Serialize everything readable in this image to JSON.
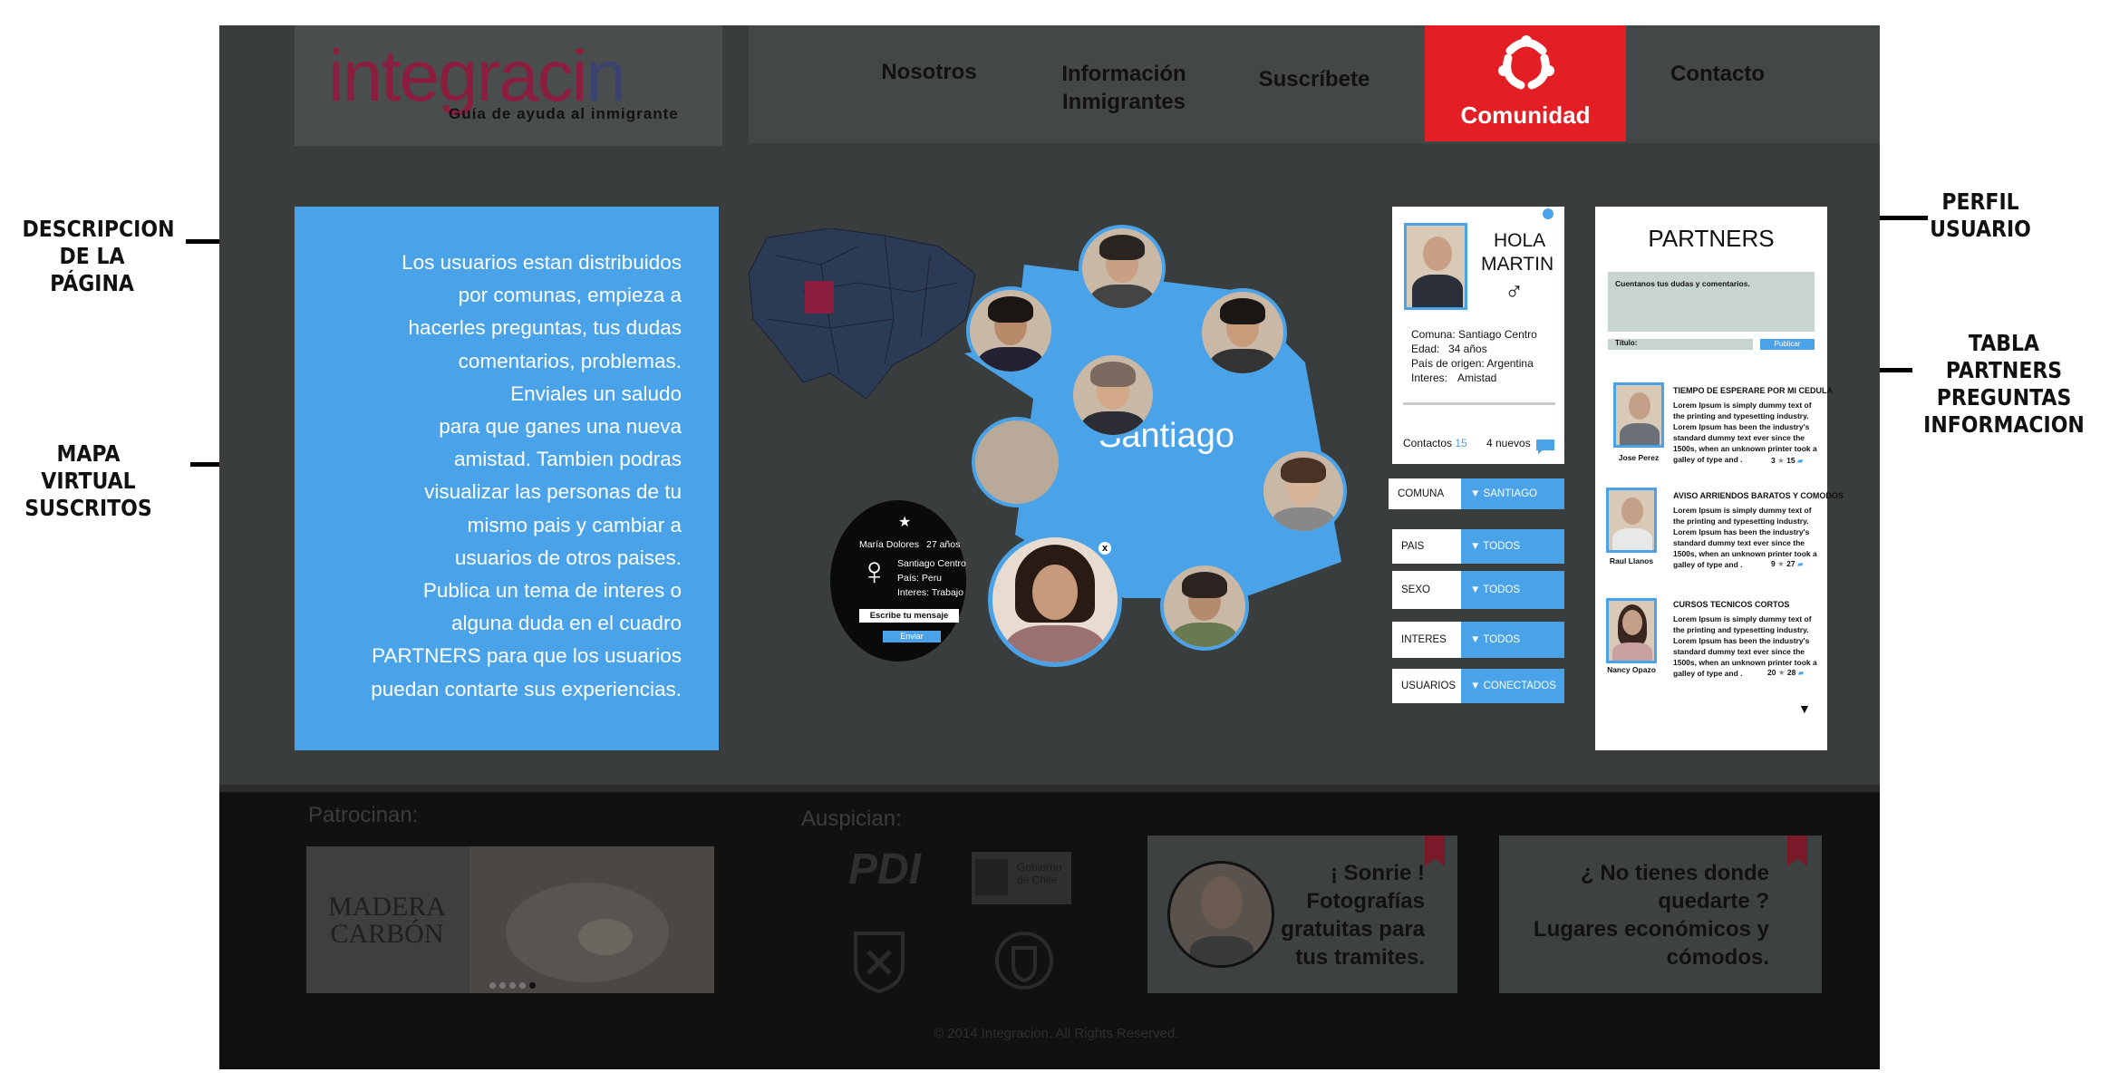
{
  "annotations": {
    "descripcion": "DESCRIPCION\nDE LA PÁGINA",
    "mapa": "MAPA VIRTUAL\nSUSCRITOS",
    "perfil": "PERFIL\nUSUARIO",
    "tabla": "TABLA PARTNERS\nPREGUNTAS\nINFORMACION"
  },
  "logo": {
    "text_a": "integraci",
    "text_b": "n",
    "subtitle": "Guía de ayuda al inmigrante"
  },
  "nav": {
    "nosotros": "Nosotros",
    "informacion": "Información\nInmigrantes",
    "suscribete": "Suscríbete",
    "comunidad": "Comunidad",
    "contacto": "Contacto",
    "accent": "#e31e24"
  },
  "description": "Los usuarios estan distribuidos\npor comunas,  empieza a\nhacerles preguntas, tus dudas\ncomentarios, problemas.\nEnviales un saludo\npara que ganes una nueva\namistad. Tambien podras\nvisualizar las personas de tu\nmismo pais y cambiar a \nusuarios de otros paises.\nPublica un tema de interes o\nalguna duda en el cuadro \nPARTNERS para que los usuarios\npuedan contarte sus experiencias.",
  "map": {
    "label": "Santiago"
  },
  "popup": {
    "name": "María Dolores",
    "age": "27 años",
    "comuna": "Santiago Centro",
    "pais": "País: Peru",
    "interes": "Interes: Trabajo",
    "message_placeholder": "Escribe tu mensaje",
    "send": "Enviar",
    "close": "x"
  },
  "profile": {
    "greeting": "HOLA",
    "name": "MARTIN",
    "gender_symbol": "♂",
    "comuna": "Comuna: Santiago Centro",
    "edad_label": "Edad:",
    "edad": "34 años",
    "pais": "País de origen: Argentina",
    "interes_label": "Interes:",
    "interes": "Amistad",
    "contactos_label": "Contactos",
    "contactos_count": "15",
    "nuevos": "4 nuevos"
  },
  "filters": [
    {
      "label": "COMUNA",
      "value": "SANTIAGO"
    },
    {
      "label": "PAIS",
      "value": "TODOS"
    },
    {
      "label": "SEXO",
      "value": "TODOS"
    },
    {
      "label": "INTERES",
      "value": "TODOS"
    },
    {
      "label": "USUARIOS",
      "value": "CONECTADOS"
    }
  ],
  "partners": {
    "title": "PARTNERS",
    "textarea_placeholder": "Cuentanos tus dudas y comentarios.",
    "titulo_label": "Título:",
    "publish": "Publicar",
    "posts": [
      {
        "title": "TIEMPO DE ESPERARE POR MI CEDULA",
        "body": "Lorem Ipsum is simply dummy text of the printing and typesetting industry. Lorem Ipsum has been the industry's standard dummy text ever since the 1500s, when an unknown printer took a galley of type and .",
        "author": "Jose Perez",
        "stars": "3",
        "comments": "15"
      },
      {
        "title": "AVISO ARRIENDOS BARATOS Y COMODOS",
        "body": "Lorem Ipsum is simply dummy text of the printing and typesetting industry. Lorem Ipsum has been the industry's standard dummy text ever since the 1500s, when an unknown printer took a galley of type and .",
        "author": "Raul Llanos",
        "stars": "9",
        "comments": "27"
      },
      {
        "title": "CURSOS TECNICOS CORTOS",
        "body": "Lorem Ipsum is simply dummy text of the printing and typesetting industry. Lorem Ipsum has been the industry's standard dummy text ever since the 1500s, when an unknown printer took a galley of type and .",
        "author": "Nancy Opazo",
        "stars": "20",
        "comments": "28"
      }
    ]
  },
  "footer": {
    "patrocinan": "Patrocinan:",
    "auspician": "Auspician:",
    "sponsor_name": "MADERA\nCARBÓN",
    "pdi": "PDI",
    "gobierno": "Gobierno\nde Chile",
    "promo1": "¡ Sonrie !\nFotografías\ngratuitas para\ntus tramites.",
    "promo2": "¿ No tienes donde\nquedarte ?\nLugares económicos y\ncómodos.",
    "copyright": "© 2014 Integracion. All Rights Reserved."
  }
}
